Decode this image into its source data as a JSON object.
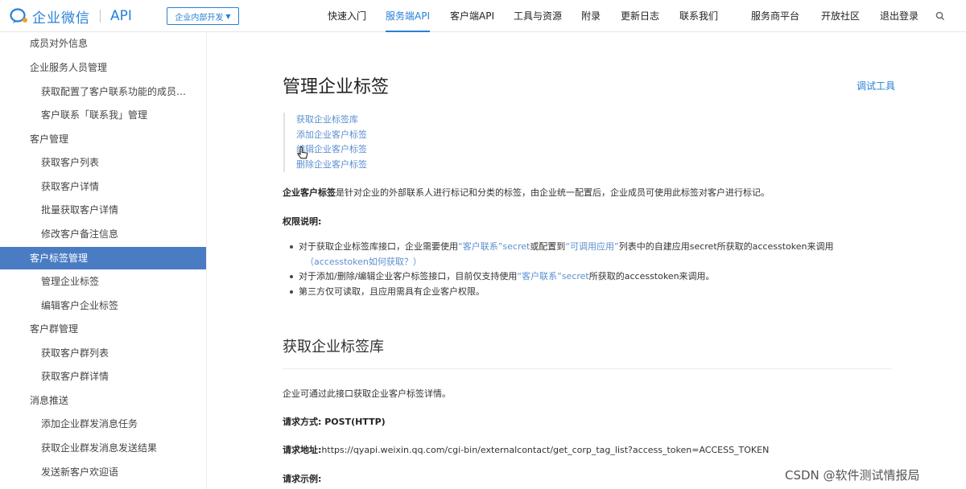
{
  "header": {
    "logo_text": "企业微信",
    "logo_api": "API",
    "dev_select": "企业内部开发",
    "nav": [
      "快速入门",
      "服务端API",
      "客户端API",
      "工具与资源",
      "附录",
      "更新日志",
      "联系我们",
      "服务商平台",
      "开放社区",
      "退出登录"
    ],
    "active_nav": "服务端API"
  },
  "sidebar": {
    "items": [
      {
        "label": "成员对外信息",
        "level": 1
      },
      {
        "label": "企业服务人员管理",
        "level": 1
      },
      {
        "label": "获取配置了客户联系功能的成员…",
        "level": 2
      },
      {
        "label": "客户联系「联系我」管理",
        "level": 2
      },
      {
        "label": "客户管理",
        "level": 1
      },
      {
        "label": "获取客户列表",
        "level": 2
      },
      {
        "label": "获取客户详情",
        "level": 2
      },
      {
        "label": "批量获取客户详情",
        "level": 2
      },
      {
        "label": "修改客户备注信息",
        "level": 2
      },
      {
        "label": "客户标签管理",
        "level": 1,
        "active": true
      },
      {
        "label": "管理企业标签",
        "level": 2
      },
      {
        "label": "编辑客户企业标签",
        "level": 2
      },
      {
        "label": "客户群管理",
        "level": 1
      },
      {
        "label": "获取客户群列表",
        "level": 2
      },
      {
        "label": "获取客户群详情",
        "level": 2
      },
      {
        "label": "消息推送",
        "level": 1
      },
      {
        "label": "添加企业群发消息任务",
        "level": 2
      },
      {
        "label": "获取企业群发消息发送结果",
        "level": 2
      },
      {
        "label": "发送新客户欢迎语",
        "level": 2
      }
    ]
  },
  "main": {
    "title": "管理企业标签",
    "debug_tool": "调试工具",
    "toc": [
      "获取企业标签库",
      "添加企业客户标签",
      "编辑企业客户标签",
      "删除企业客户标签"
    ],
    "intro_bold": "企业客户标签",
    "intro_rest": "是针对企业的外部联系人进行标记和分类的标签，由企业统一配置后，企业成员可使用此标签对客户进行标记。",
    "perm_title": "权限说明:",
    "b1_pre": "对于获取企业标签库接口，企业需要使用",
    "b1_link1": "“客户联系”secret",
    "b1_mid": "或配置到",
    "b1_link2": "“可调用应用”",
    "b1_post": "列表中的自建应用secret所获取的accesstoken来调用",
    "b1_cont": "（accesstoken如何获取？）",
    "b2_pre": "对于添加/删除/编辑企业客户标签接口，目前仅支持使用",
    "b2_link": "“客户联系”secret",
    "b2_post": "所获取的accesstoken来调用。",
    "b3": "第三方仅可读取，且应用需具有企业客户权限。",
    "section_title": "获取企业标签库",
    "section_desc": "企业可通过此接口获取企业客户标签详情。",
    "method_label": "请求方式: ",
    "method_value": "POST(HTTP)",
    "url_label": "请求地址:",
    "url_value": "https://qyapi.weixin.qq.com/cgi-bin/externalcontact/get_corp_tag_list?access_token=ACCESS_TOKEN",
    "example_label": "请求示例:"
  },
  "watermark": "CSDN @软件测试情报局",
  "colors": {
    "accent": "#2680d7",
    "sidebar_active": "#4a7cc4",
    "link": "#5b8fd0"
  }
}
